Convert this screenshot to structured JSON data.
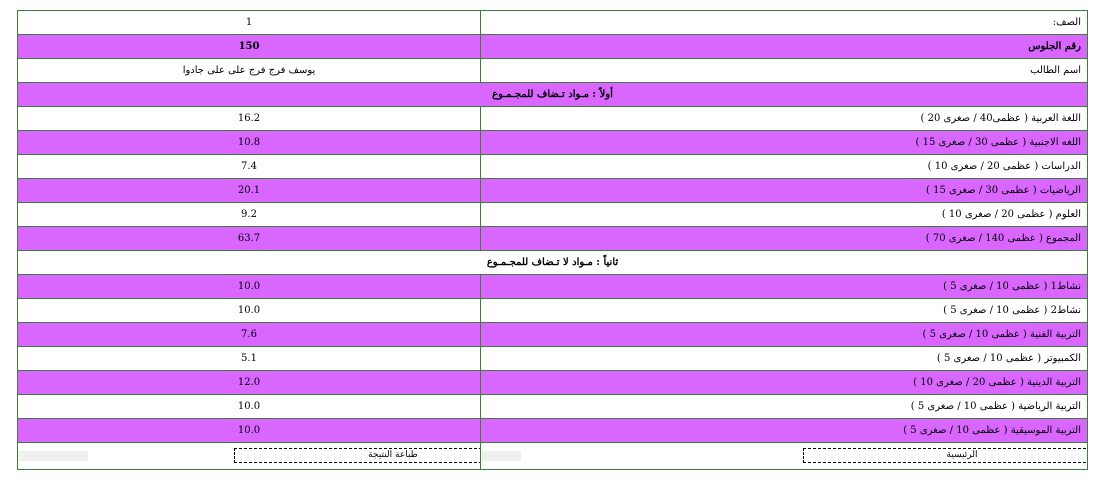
{
  "header_rows": [
    {
      "label": "الصف:",
      "value": "1"
    },
    {
      "label": "رقم الجلوس",
      "value": "150"
    },
    {
      "label": "اسم الطالب",
      "value": "يوسف فرج فرج على على جادوا"
    }
  ],
  "section1": {
    "title": "أولاً : مـواد تـضاف للمجـمـوع",
    "rows": [
      {
        "label": "اللغة العربية ( عظمى40 / صغرى 20 )",
        "value": "16.2"
      },
      {
        "label": "اللغه الاجنبية ( عظمى 30 / صغرى 15 )",
        "value": "10.8"
      },
      {
        "label": "الدراسات ( عظمى 20 / صغرى 10 )",
        "value": "7.4"
      },
      {
        "label": "الرياضيات ( عظمى 30 / صغرى 15 )",
        "value": "20.1"
      },
      {
        "label": "العلوم ( عظمى 20 / صغرى 10 )",
        "value": "9.2"
      },
      {
        "label": "المجموع ( عظمى 140 / صغرى 70 )",
        "value": "63.7"
      }
    ]
  },
  "section2": {
    "title": "ثانياً : مـواد لا تـضاف للمجـمـوع",
    "rows": [
      {
        "label": "نشاط1 ( عظمى 10 / صغرى 5 )",
        "value": "10.0"
      },
      {
        "label": "نشاط2 ( عظمى 10 / صغرى 5 )",
        "value": "10.0"
      },
      {
        "label": "التربية الفنية ( عظمى 10 / صغرى 5 )",
        "value": "7.6"
      },
      {
        "label": "الكمبيوتر ( عظمى 10 / صغرى 5 )",
        "value": "5.1"
      },
      {
        "label": "التربية الدينية ( عظمى 20 / صغرى 10 )",
        "value": "12.0"
      },
      {
        "label": "التربية الرياضية ( عظمى 10 / صغرى 5 )",
        "value": "10.0"
      },
      {
        "label": "التربية الموسيقية ( عظمى 10 / صغرى 5 )",
        "value": "10.0"
      }
    ]
  },
  "footer": {
    "home_label": "الرئيسية",
    "print_label": "طباعة النتيجة"
  },
  "colors": {
    "row_purple": "#d966ff",
    "border_green": "#3c7d3c"
  }
}
